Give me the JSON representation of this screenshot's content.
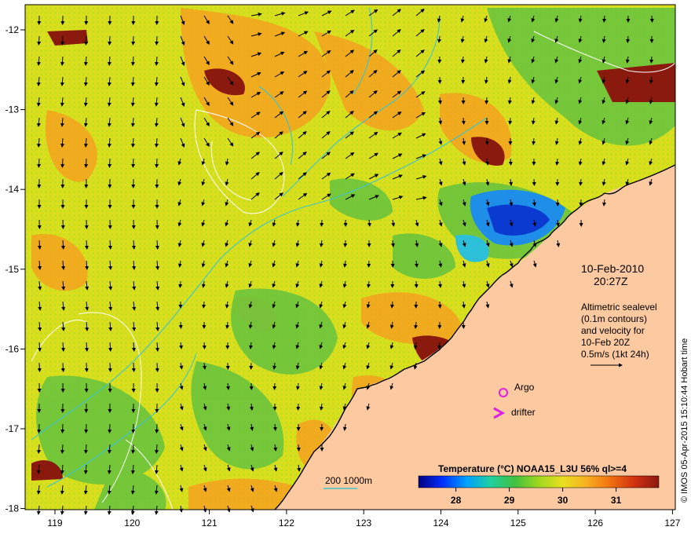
{
  "map": {
    "lon_ticks": [
      "119",
      "120",
      "121",
      "122",
      "123",
      "124",
      "125",
      "126",
      "127"
    ],
    "lat_ticks": [
      "-12",
      "-13",
      "-14",
      "-15",
      "-16",
      "-17",
      "-18"
    ],
    "colors": {
      "land": "#fcc9a0",
      "warm": "#f5a21f",
      "mid": "#d6e21c",
      "cool": "#6cc43c",
      "cold": "#0a5ad8",
      "hot": "#8b1a0e",
      "bathymetry_contour": "#3fc4cc",
      "sealevel_contour": "#ffffff",
      "argo": "#e01ee0",
      "drifter": "#e01ee0"
    }
  },
  "annotations": {
    "date": "10-Feb-2010",
    "time": "20:27Z",
    "note_lines": [
      "Altimetric sealevel",
      "(0.1m contours)",
      "and velocity for",
      "10-Feb 20Z",
      "0.5m/s (1kt 24h)"
    ],
    "argo_label": "Argo",
    "drifter_label": "drifter",
    "bathy_label": "200  1000m",
    "credit": "© IMOS 05-Apr-2015 15:10:44 Hobart time"
  },
  "colorbar": {
    "title": "Temperature (°C) NOAA15_L3U 56% ql>=4",
    "ticks": [
      "28",
      "29",
      "30",
      "31"
    ],
    "range": [
      27.3,
      31.8
    ],
    "stops": [
      "#00007f",
      "#0030ff",
      "#00a0ff",
      "#20d0a0",
      "#40c040",
      "#a0d820",
      "#e8e020",
      "#f8b020",
      "#f07010",
      "#d03010",
      "#8b1a0e"
    ]
  }
}
